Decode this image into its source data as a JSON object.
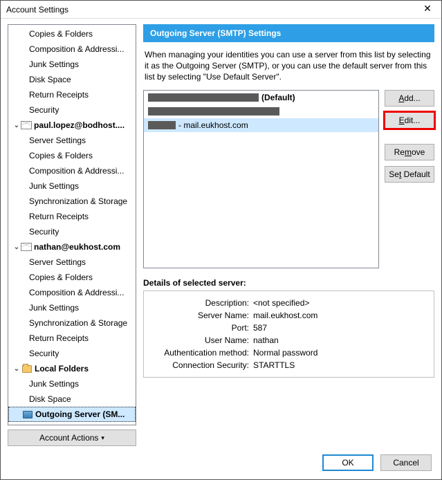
{
  "window": {
    "title": "Account Settings",
    "close": "✕"
  },
  "tree": {
    "orphan": [
      "Copies & Folders",
      "Composition & Addressi...",
      "Junk Settings",
      "Disk Space",
      "Return Receipts",
      "Security"
    ],
    "accounts": [
      {
        "label": "paul.lopez@bodhost....",
        "children": [
          "Server Settings",
          "Copies & Folders",
          "Composition & Addressi...",
          "Junk Settings",
          "Synchronization & Storage",
          "Return Receipts",
          "Security"
        ]
      },
      {
        "label": "nathan@eukhost.com",
        "children": [
          "Server Settings",
          "Copies & Folders",
          "Composition & Addressi...",
          "Junk Settings",
          "Synchronization & Storage",
          "Return Receipts",
          "Security"
        ]
      }
    ],
    "local": {
      "label": "Local Folders",
      "children": [
        "Junk Settings",
        "Disk Space"
      ]
    },
    "smtp": "Outgoing Server (SM..."
  },
  "accountActions": "Account Actions",
  "panel": {
    "title": "Outgoing Server (SMTP) Settings",
    "desc": "When managing your identities you can use a server from this list by selecting it as the Outgoing Server (SMTP), or you can use the default server from this list by selecting \"Use Default Server\"."
  },
  "servers": {
    "items": [
      {
        "suffix": "(Default)"
      },
      {
        "suffix": ""
      },
      {
        "suffix": "- mail.eukhost.com"
      }
    ]
  },
  "buttons": {
    "add": "Add...",
    "edit": "Edit...",
    "remove": "Remove",
    "setdef": "Set Default"
  },
  "details": {
    "title": "Details of selected server:",
    "rows": [
      {
        "label": "Description:",
        "value": "<not specified>"
      },
      {
        "label": "Server Name:",
        "value": "mail.eukhost.com"
      },
      {
        "label": "Port:",
        "value": "587"
      },
      {
        "label": "User Name:",
        "value": "nathan"
      },
      {
        "label": "Authentication method:",
        "value": "Normal password"
      },
      {
        "label": "Connection Security:",
        "value": "STARTTLS"
      }
    ]
  },
  "footer": {
    "ok": "OK",
    "cancel": "Cancel"
  }
}
